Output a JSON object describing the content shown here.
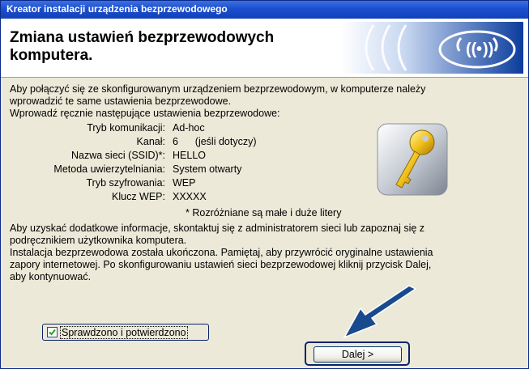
{
  "window": {
    "title": "Kreator instalacji urządzenia bezprzewodowego"
  },
  "header": {
    "heading_line1": "Zmiana ustawień bezprzewodowych",
    "heading_line2": "komputera."
  },
  "intro": {
    "line1": "Aby połączyć się ze skonfigurowanym urządzeniem bezprzewodowym, w komputerze należy",
    "line2": "wprowadzić te same ustawienia bezprzewodowe.",
    "line3": "Wprowadź ręcznie następujące ustawienia bezprzewodowe:"
  },
  "settings": [
    {
      "label": "Tryb komunikacji:",
      "value": "Ad-hoc"
    },
    {
      "label": "Kanał:",
      "value": "6      (jeśli dotyczy)"
    },
    {
      "label": "Nazwa sieci (SSID)*:",
      "value": "HELLO"
    },
    {
      "label": "Metoda uwierzytelniania:",
      "value": "System otwarty"
    },
    {
      "label": "Tryb szyfrowania:",
      "value": "WEP"
    },
    {
      "label": "Klucz WEP:",
      "value": "XXXXX"
    }
  ],
  "note": "* Rozróżniane są małe i duże litery",
  "info": {
    "line1": "Aby uzyskać dodatkowe informacje, skontaktuj się z administratorem sieci lub zapoznaj się z",
    "line2": "podręcznikiem użytkownika komputera.",
    "line3": "Instalacja bezprzewodowa została ukończona. Pamiętaj, aby przywrócić oryginalne ustawienia",
    "line4": "zapory internetowej. Po skonfigurowaniu ustawień sieci bezprzewodowej kliknij przycisk Dalej,",
    "line5": "aby kontynuować."
  },
  "checkbox": {
    "label": "Sprawdzono i potwierdzono",
    "checked": true
  },
  "buttons": {
    "next_label": "Dalej >"
  },
  "icons": {
    "logo": "wireless-signal-icon",
    "key": "key-icon",
    "arrow": "pointer-arrow-icon"
  },
  "colors": {
    "titlebar": "#1c4fcf",
    "panel": "#ece9d8",
    "arrow": "#1a4a8e"
  }
}
